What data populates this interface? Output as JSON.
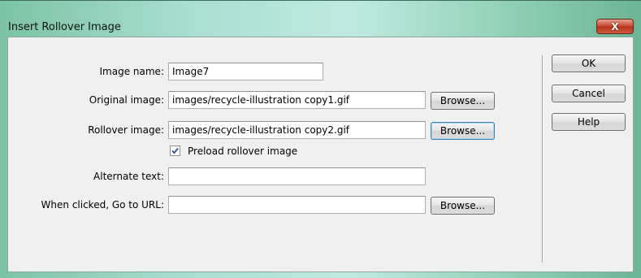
{
  "window": {
    "title": "Insert Rollover Image",
    "close_glyph": "X"
  },
  "form": {
    "image_name": {
      "label": "Image name:",
      "value": "Image7"
    },
    "original_image": {
      "label": "Original image:",
      "value": "images/recycle-illustration copy1.gif",
      "browse": "Browse..."
    },
    "rollover_image": {
      "label": "Rollover image:",
      "value": "images/recycle-illustration copy2.gif",
      "browse": "Browse..."
    },
    "preload": {
      "label": "Preload rollover image",
      "checked": true
    },
    "alternate_text": {
      "label": "Alternate text:",
      "value": ""
    },
    "goto_url": {
      "label": "When clicked, Go to URL:",
      "value": "",
      "browse": "Browse..."
    }
  },
  "actions": {
    "ok": "OK",
    "cancel": "Cancel",
    "help": "Help"
  }
}
